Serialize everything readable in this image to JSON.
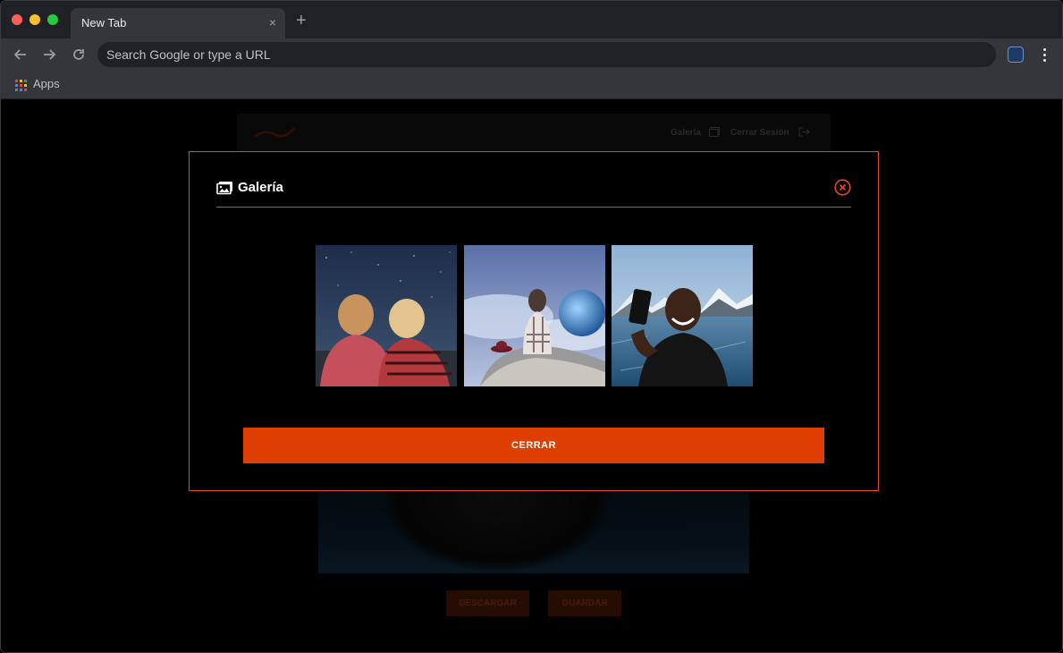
{
  "browser": {
    "tab_title": "New Tab",
    "tab_close": "×",
    "new_tab": "+",
    "omnibox_placeholder": "Search Google or type a URL",
    "bookmarks": {
      "apps_label": "Apps"
    }
  },
  "app": {
    "nav": {
      "galeria": "Galería",
      "cerrar_sesion": "Cerrar Sesión"
    },
    "buttons": {
      "descargar": "DESCARGAR",
      "guardar": "GUARDAR"
    }
  },
  "modal": {
    "title": "Galería",
    "thumbnails": [
      {
        "name": "couple-under-stars"
      },
      {
        "name": "girl-on-rock-planet"
      },
      {
        "name": "man-selfie-lake"
      }
    ],
    "close_button": "CERRAR"
  },
  "colors": {
    "accent": "#de3f00",
    "modal_border": "#e04a1e"
  }
}
